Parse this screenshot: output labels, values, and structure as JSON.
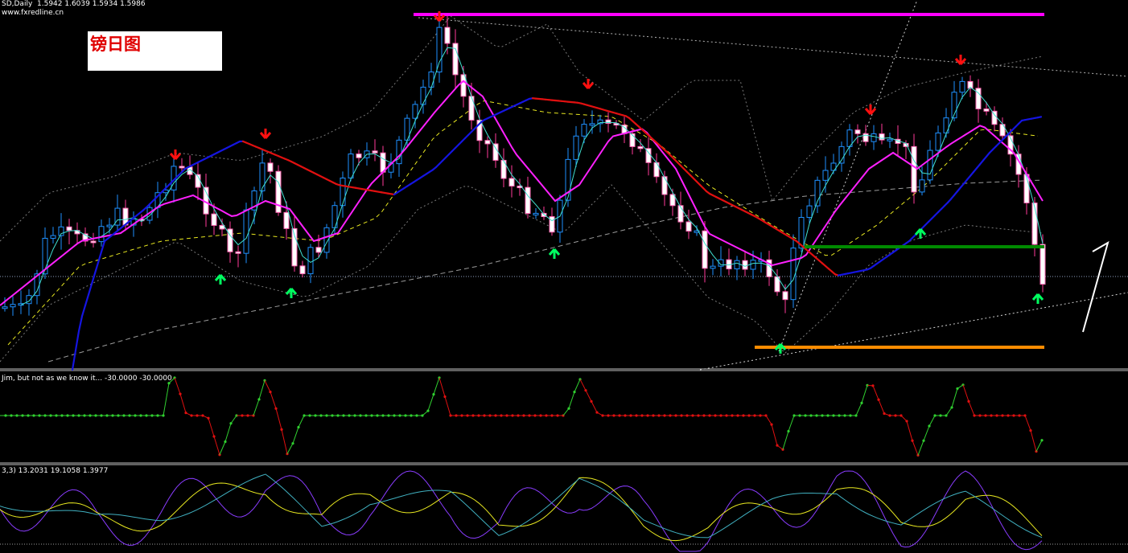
{
  "header": {
    "symbol": "SD,Daily",
    "ohlc": "1.5942 1.6039 1.5934 1.5986",
    "site": "www.fxredline.cn"
  },
  "title_box": {
    "text": "镑日图"
  },
  "panel2": {
    "label": "Jim, but not as we know it...  -30.0000 -30.0000"
  },
  "panel3": {
    "label": "3,3) 13.2031 19.1058 1.3977"
  },
  "colors": {
    "background": "#000000",
    "bull_candle": "#1e90ff",
    "bear_candle": "#ff69b4",
    "ma_rising": "#1515e0",
    "ma_falling": "#e01010",
    "ma_fast": "#ff20ff",
    "ma_cyan": "#40e0d0",
    "ma_yellow": "#e8e820",
    "support_green": "#008a00",
    "resistance_magenta": "#ff00ff",
    "low_orange": "#ff8c00",
    "arrow_up": "#00ff60",
    "arrow_down": "#ff1010"
  },
  "chart_data": {
    "type": "candlestick",
    "series_count": 130,
    "levels": {
      "resistance": 1.66,
      "support": 1.605,
      "low": 1.58,
      "current": 1.5986
    }
  }
}
